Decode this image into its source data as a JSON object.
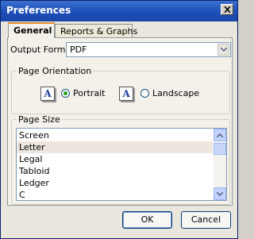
{
  "window": {
    "title": "Preferences"
  },
  "tabs": [
    {
      "label": "General",
      "active": true
    },
    {
      "label": "Reports & Graphs",
      "active": false
    }
  ],
  "output_format": {
    "label": "Output Format",
    "value": "PDF"
  },
  "orientation": {
    "group_label": "Page Orientation",
    "icon_letter": "A",
    "options": [
      {
        "label": "Portrait",
        "selected": true
      },
      {
        "label": "Landscape",
        "selected": false
      }
    ]
  },
  "page_size": {
    "group_label": "Page Size",
    "items": [
      "Screen",
      "Letter",
      "Legal",
      "Tabloid",
      "Ledger",
      "C"
    ],
    "selected": "Letter"
  },
  "buttons": {
    "ok": "OK",
    "cancel": "Cancel"
  },
  "colors": {
    "titlebar": "#1d4fb7",
    "radio_dot": "#21a121",
    "icon_letter": "#1c3f9c"
  }
}
